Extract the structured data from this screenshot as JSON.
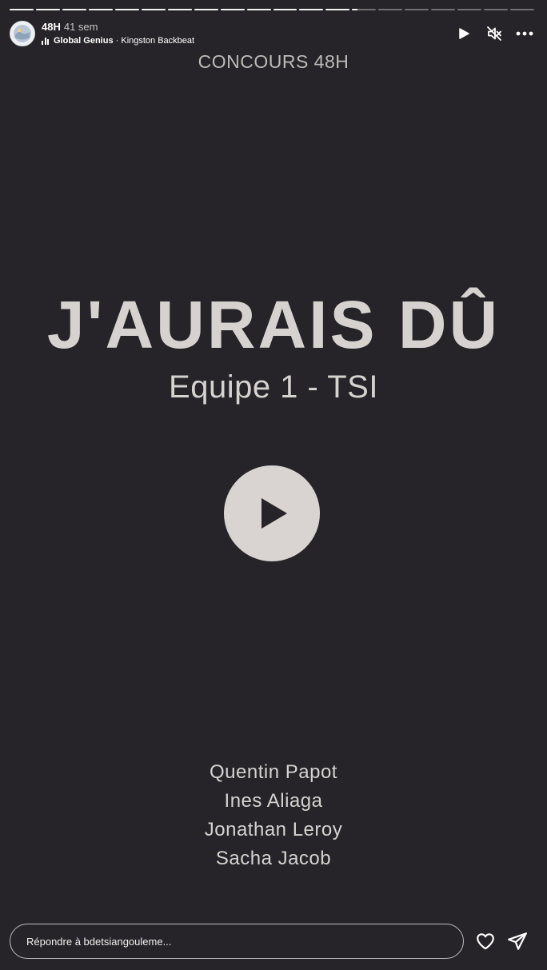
{
  "progress": {
    "segments": [
      1,
      1,
      1,
      1,
      1,
      1,
      1,
      1,
      1,
      1,
      1,
      1,
      1,
      0.22,
      0,
      0,
      0,
      0,
      0,
      0
    ]
  },
  "header": {
    "username": "48H",
    "time_ago": "41 sem",
    "music": {
      "artist": "Global Genius",
      "separator": " · ",
      "track": "Kingston Backbeat"
    },
    "icons": [
      "play-icon",
      "muted-speaker-icon",
      "more-options-icon"
    ]
  },
  "story": {
    "top_label": "CONCOURS 48H",
    "title": "J'AURAIS DÛ",
    "subtitle": "Equipe 1 - TSI",
    "credits": [
      "Quentin Papot",
      "Ines Aliaga",
      "Jonathan Leroy",
      "Sacha Jacob"
    ]
  },
  "reply": {
    "placeholder": "Répondre à bdetsiangouleme..."
  },
  "colors": {
    "background": "#262428",
    "story_text": "#d6d2d0",
    "play_circle": "#d9d4d1"
  }
}
